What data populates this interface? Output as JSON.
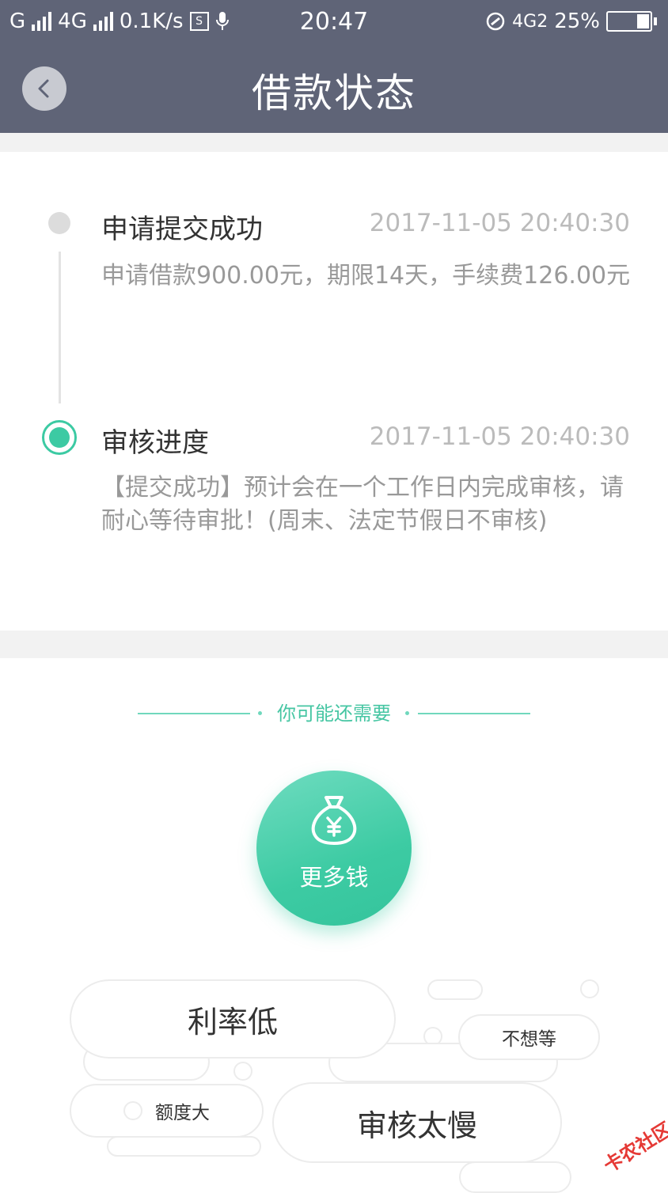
{
  "status_bar": {
    "sim1": "G",
    "sim2": "4G",
    "speed": "0.1K/s",
    "s_icon_text": "S",
    "time": "20:47",
    "net": "4G2",
    "battery": "25%",
    "battery_level": 0.25
  },
  "header": {
    "title": "借款状态",
    "back_icon": "chevron-left-icon"
  },
  "timeline": [
    {
      "title": "申请提交成功",
      "time": "2017-11-05 20:40:30",
      "desc": "申请借款900.00元，期限14天，手续费126.00元",
      "state": "done"
    },
    {
      "title": "审核进度",
      "time": "2017-11-05 20:40:30",
      "desc": "【提交成功】预计会在一个工作日内完成审核，请耐心等待审批！(周末、法定节假日不审核)",
      "state": "active"
    }
  ],
  "recommend": {
    "heading": "你可能还需要",
    "button_label": "更多钱",
    "button_icon": "money-bag-icon",
    "tags": [
      "利率低",
      "不想等",
      "额度大",
      "审核太慢"
    ]
  },
  "colors": {
    "header_bg": "#5f6477",
    "accent": "#3ccaa3",
    "muted_text": "#999999"
  },
  "watermark": "卡农社区"
}
